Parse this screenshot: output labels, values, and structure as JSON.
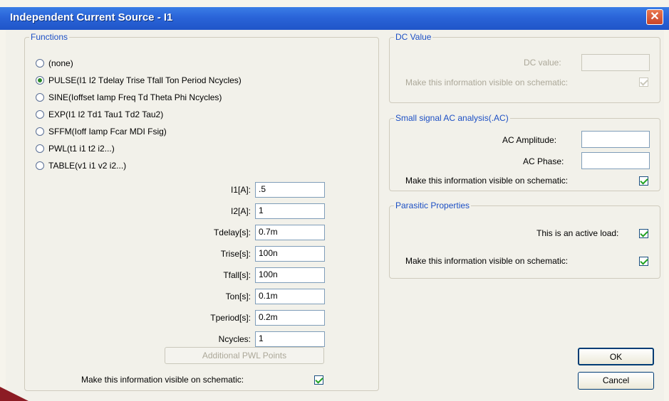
{
  "window": {
    "title": "Independent Current Source - I1",
    "close_glyph": "✕"
  },
  "functions": {
    "legend": "Functions",
    "options": [
      {
        "label": "(none)",
        "selected": false
      },
      {
        "label": "PULSE(I1 I2 Tdelay Trise Tfall Ton Period Ncycles)",
        "selected": true
      },
      {
        "label": "SINE(Ioffset Iamp Freq Td Theta Phi Ncycles)",
        "selected": false
      },
      {
        "label": "EXP(I1 I2 Td1 Tau1 Td2 Tau2)",
        "selected": false
      },
      {
        "label": "SFFM(Ioff Iamp Fcar MDI Fsig)",
        "selected": false
      },
      {
        "label": "PWL(t1 i1 t2 i2...)",
        "selected": false
      },
      {
        "label": "TABLE(v1 i1 v2 i2...)",
        "selected": false
      }
    ],
    "params": [
      {
        "label": "I1[A]:",
        "value": ".5"
      },
      {
        "label": "I2[A]:",
        "value": "1"
      },
      {
        "label": "Tdelay[s]:",
        "value": "0.7m"
      },
      {
        "label": "Trise[s]:",
        "value": "100n"
      },
      {
        "label": "Tfall[s]:",
        "value": "100n"
      },
      {
        "label": "Ton[s]:",
        "value": "0.1m"
      },
      {
        "label": "Tperiod[s]:",
        "value": "0.2m"
      },
      {
        "label": "Ncycles:",
        "value": "1"
      }
    ],
    "pwl_button": "Additional PWL Points",
    "visible_label": "Make this information visible on schematic:",
    "visible_checked": true
  },
  "dc": {
    "legend": "DC Value",
    "value_label": "DC value:",
    "value": "",
    "visible_label": "Make this information visible on schematic:",
    "visible_checked": true
  },
  "ac": {
    "legend": "Small signal AC analysis(.AC)",
    "amplitude_label": "AC Amplitude:",
    "amplitude": "",
    "phase_label": "AC Phase:",
    "phase": "",
    "visible_label": "Make this information visible on schematic:",
    "visible_checked": true
  },
  "parasitic": {
    "legend": "Parasitic Properties",
    "active_load_label": "This is an active load:",
    "active_load_checked": true,
    "visible_label": "Make this information visible on schematic:",
    "visible_checked": true
  },
  "buttons": {
    "ok": "OK",
    "cancel": "Cancel"
  },
  "colors": {
    "titlebar": "#2a64d8",
    "legend_text": "#1c4fc4",
    "check_mark": "#21a121"
  }
}
